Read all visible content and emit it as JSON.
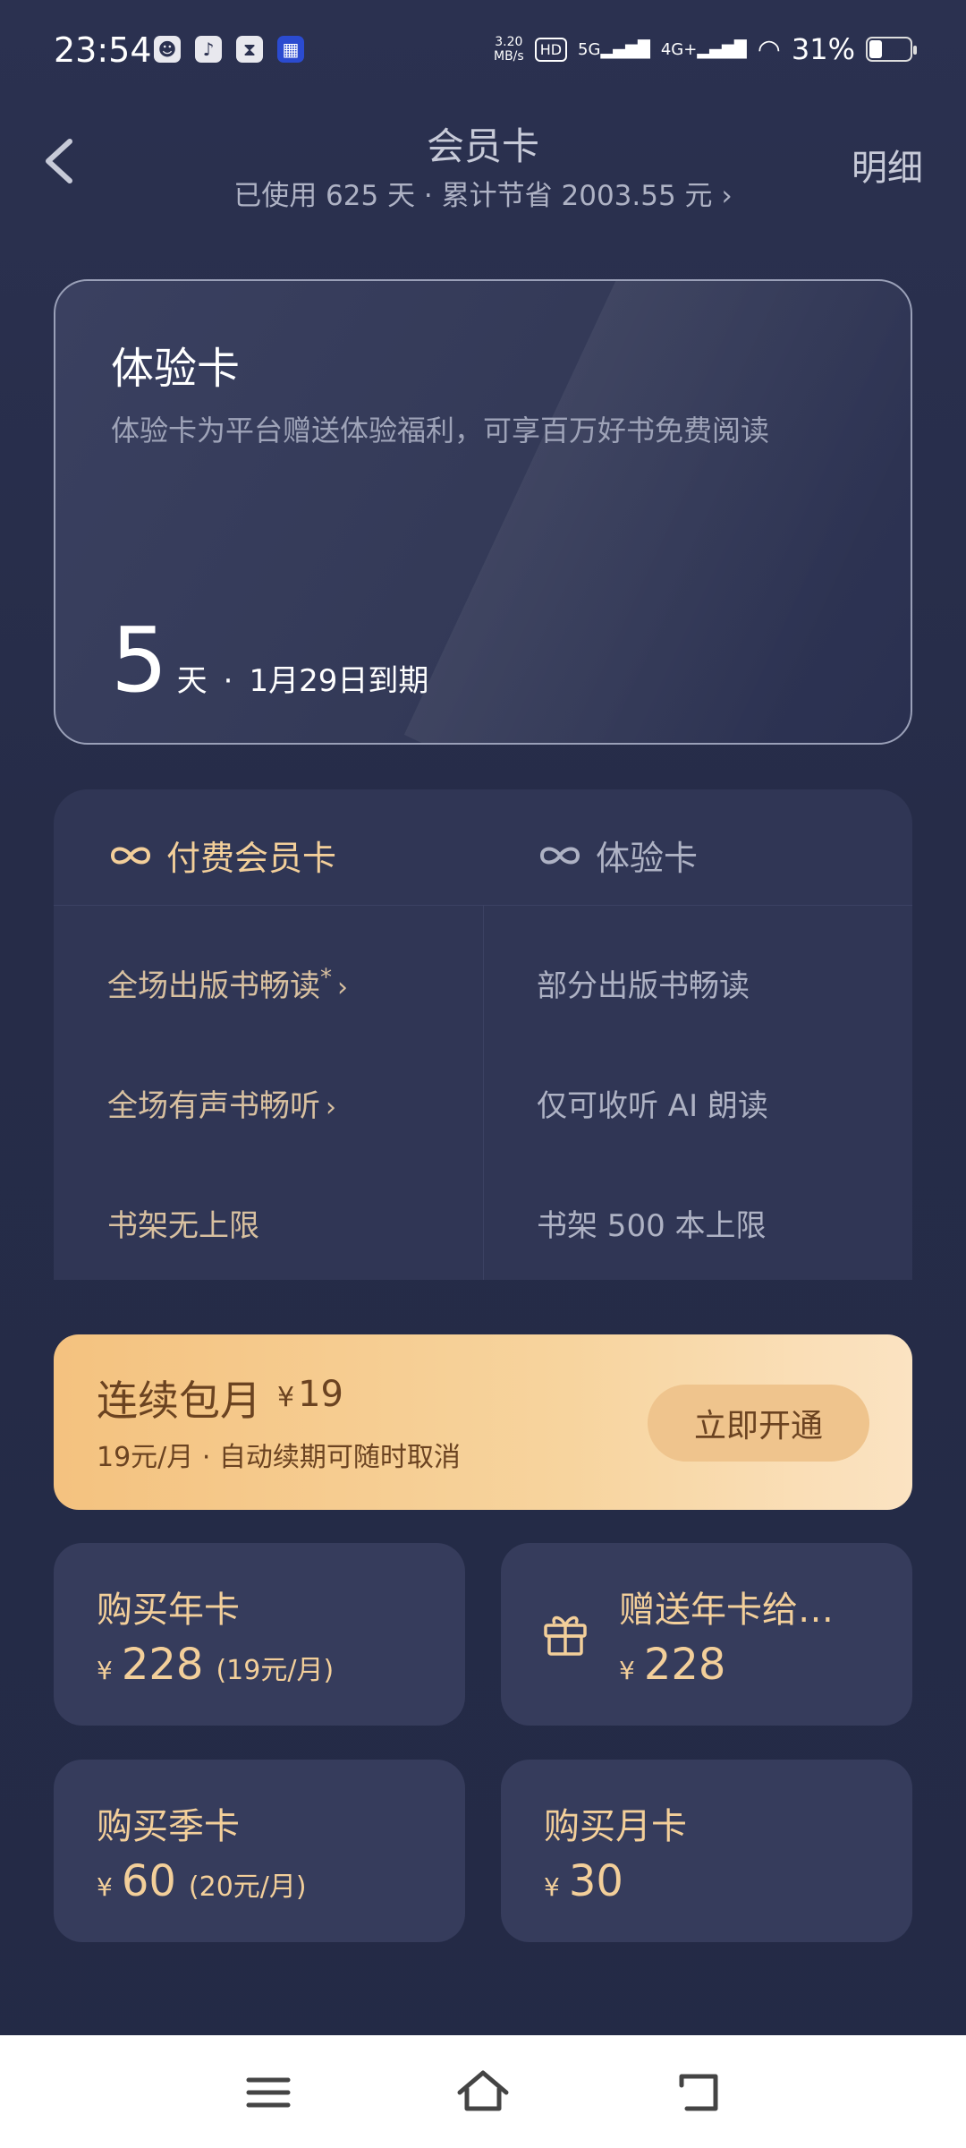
{
  "status_bar": {
    "time": "23:54",
    "net_speed_top": "3.20",
    "net_speed_bottom": "MB/s",
    "hd": "HD",
    "sim1": "5G",
    "sim2": "4G+",
    "battery": "31%"
  },
  "header": {
    "title": "会员卡",
    "subtitle": "已使用 625 天 · 累计节省 2003.55 元 ›",
    "detail": "明细"
  },
  "trial_card": {
    "title": "体验卡",
    "description": "体验卡为平台赠送体验福利，可享百万好书免费阅读",
    "days": "5",
    "days_unit": "天",
    "separator": "·",
    "expire": "1月29日到期"
  },
  "compare": {
    "paid_label": "付费会员卡",
    "trial_label": "体验卡",
    "rows": [
      {
        "paid": "全场出版书畅读",
        "paid_mark": "*",
        "paid_link": true,
        "trial": "部分出版书畅读"
      },
      {
        "paid": "全场有声书畅听",
        "paid_mark": "",
        "paid_link": true,
        "trial": "仅可收听 AI 朗读"
      },
      {
        "paid": "书架无上限",
        "paid_mark": "",
        "paid_link": false,
        "trial": "书架 500 本上限"
      }
    ]
  },
  "monthly": {
    "title": "连续包月",
    "currency": "¥",
    "price": "19",
    "description": "19元/月 · 自动续期可随时取消",
    "button": "立即开通"
  },
  "plans": {
    "year": {
      "title": "购买年卡",
      "currency": "¥",
      "price": "228",
      "per": "(19元/月)"
    },
    "gift": {
      "title": "赠送年卡给…",
      "currency": "¥",
      "price": "228"
    },
    "quarter": {
      "title": "购买季卡",
      "currency": "¥",
      "price": "60",
      "per": "(20元/月)"
    },
    "month": {
      "title": "购买月卡",
      "currency": "¥",
      "price": "30"
    }
  },
  "colors": {
    "background": "#262c48",
    "gold": "#f3cf9a",
    "monthly_bg": "#f7d49e",
    "brown_text": "#6b4321"
  }
}
